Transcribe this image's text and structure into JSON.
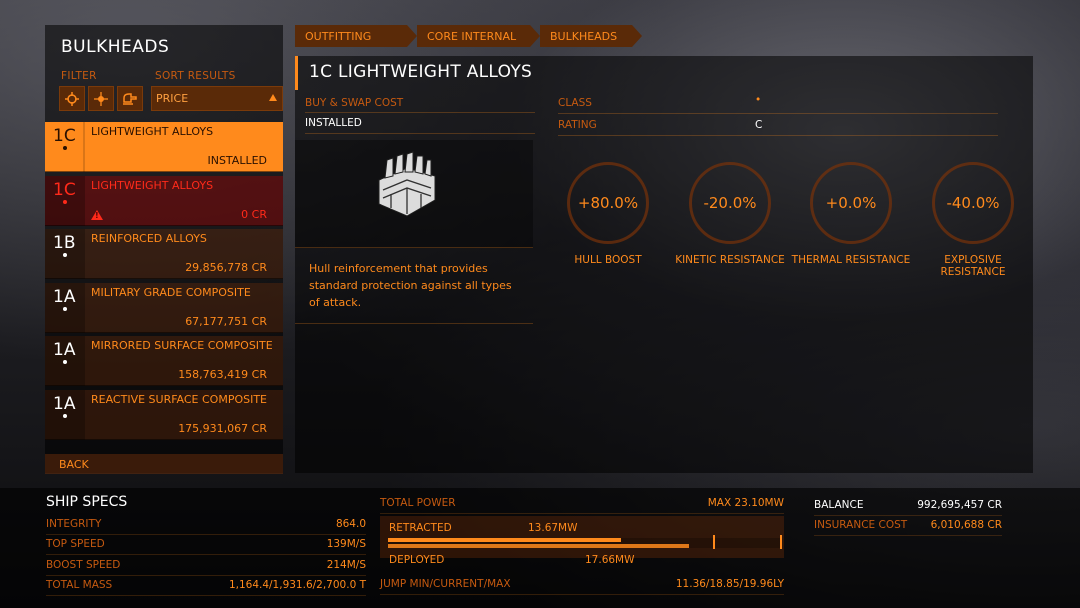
{
  "left": {
    "title": "BULKHEADS",
    "filter_label": "FILTER",
    "sort_label": "SORT RESULTS",
    "sort_value": "PRICE",
    "back_label": "BACK",
    "items": [
      {
        "grade": "1C",
        "name": "LIGHTWEIGHT ALLOYS",
        "price": "INSTALLED",
        "state": "selected"
      },
      {
        "grade": "1C",
        "name": "LIGHTWEIGHT ALLOYS",
        "price": "0 CR",
        "state": "warning"
      },
      {
        "grade": "1B",
        "name": "REINFORCED ALLOYS",
        "price": "29,856,778 CR",
        "state": "normal"
      },
      {
        "grade": "1A",
        "name": "MILITARY GRADE COMPOSITE",
        "price": "67,177,751 CR",
        "state": "normal"
      },
      {
        "grade": "1A",
        "name": "MIRRORED SURFACE COMPOSITE",
        "price": "158,763,419 CR",
        "state": "normal"
      },
      {
        "grade": "1A",
        "name": "REACTIVE SURFACE COMPOSITE",
        "price": "175,931,067 CR",
        "state": "normal"
      }
    ]
  },
  "breadcrumb": [
    "OUTFITTING",
    "CORE INTERNAL",
    "BULKHEADS"
  ],
  "module": {
    "title": "1C LIGHTWEIGHT ALLOYS",
    "cost_label": "BUY & SWAP COST",
    "cost_value": "INSTALLED",
    "class_label": "CLASS",
    "class_value": "•",
    "rating_label": "RATING",
    "rating_value": "C",
    "description": "Hull reinforcement that provides standard protection against all types of attack.",
    "stats": [
      {
        "value": "+80.0%",
        "label": "HULL BOOST"
      },
      {
        "value": "-20.0%",
        "label": "KINETIC RESISTANCE"
      },
      {
        "value": "+0.0%",
        "label": "THERMAL RESISTANCE"
      },
      {
        "value": "-40.0%",
        "label": "EXPLOSIVE RESISTANCE"
      }
    ]
  },
  "ship_specs": {
    "title": "SHIP SPECS",
    "rows": [
      {
        "label": "INTEGRITY",
        "value": "864.0"
      },
      {
        "label": "TOP SPEED",
        "value": "139M/S"
      },
      {
        "label": "BOOST SPEED",
        "value": "214M/S"
      },
      {
        "label": "TOTAL MASS",
        "value": "1,164.4/1,931.6/2,700.0 T"
      }
    ]
  },
  "power": {
    "total_label": "TOTAL POWER",
    "max_value": "MAX 23.10MW",
    "retracted_label": "RETRACTED",
    "retracted_value": "13.67MW",
    "retracted_fraction": 0.592,
    "deployed_label": "DEPLOYED",
    "deployed_value": "17.66MW",
    "deployed_fraction": 0.765,
    "jump_label": "JUMP MIN/CURRENT/MAX",
    "jump_value": "11.36/18.85/19.96LY"
  },
  "balance": {
    "balance_label": "BALANCE",
    "balance_value": "992,695,457 CR",
    "insurance_label": "INSURANCE COST",
    "insurance_value": "6,010,688 CR"
  },
  "colors": {
    "accent": "#ff8a1c",
    "warning": "#ff2a1a"
  }
}
